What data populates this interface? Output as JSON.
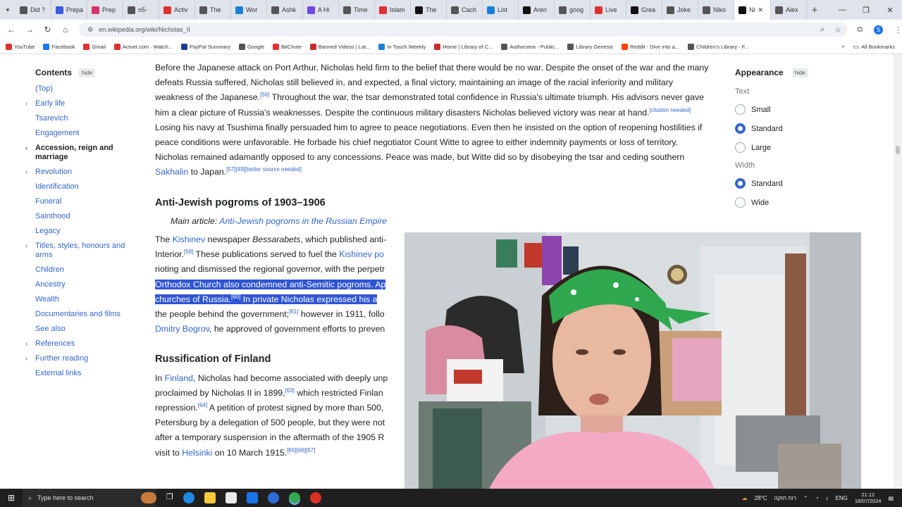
{
  "browser": {
    "tabs": [
      {
        "label": "Did ?",
        "color": "#555"
      },
      {
        "label": "Prepa",
        "color": "#3b5bdb"
      },
      {
        "label": "Prep",
        "color": "#d6336c"
      },
      {
        "label": "n5-",
        "color": "#555"
      },
      {
        "label": "Activ",
        "color": "#e03131"
      },
      {
        "label": "The",
        "color": "#555"
      },
      {
        "label": "Wor",
        "color": "#1c7ed6"
      },
      {
        "label": "Ashk",
        "color": "#555"
      },
      {
        "label": "A Hi",
        "color": "#7048e8"
      },
      {
        "label": "Time",
        "color": "#555"
      },
      {
        "label": "Islam",
        "color": "#e03131"
      },
      {
        "label": "The",
        "color": "#111"
      },
      {
        "label": "Cach",
        "color": "#555"
      },
      {
        "label": "List",
        "color": "#1c7ed6"
      },
      {
        "label": "Aren",
        "color": "#111"
      },
      {
        "label": "goog",
        "color": "#555"
      },
      {
        "label": "Live",
        "color": "#e03131"
      },
      {
        "label": "Grea",
        "color": "#111"
      },
      {
        "label": "Joke",
        "color": "#555"
      },
      {
        "label": "Niko",
        "color": "#555"
      },
      {
        "label": "Ni",
        "color": "#111",
        "active": true
      },
      {
        "label": "Alex",
        "color": "#555"
      }
    ],
    "url": "en.wikipedia.org/wiki/Nicholas_II",
    "bookmarks": [
      {
        "label": "YouTube",
        "color": "#e03131"
      },
      {
        "label": "Facebook",
        "color": "#1877f2"
      },
      {
        "label": "Gmail",
        "color": "#e03131"
      },
      {
        "label": "Actvet.com · Watch...",
        "color": "#e03131"
      },
      {
        "label": "PayPal Summary",
        "color": "#1c3f94"
      },
      {
        "label": "Google",
        "color": "#555"
      },
      {
        "label": "BitChute",
        "color": "#e03131"
      },
      {
        "label": "Banned Videos | Lat...",
        "color": "#c92a2a"
      },
      {
        "label": "In Touch Weekly",
        "color": "#1c7ed6"
      },
      {
        "label": "Home | Library of C...",
        "color": "#c92a2a"
      },
      {
        "label": "Authorsera - Public...",
        "color": "#555"
      },
      {
        "label": "Library Genesis",
        "color": "#555"
      },
      {
        "label": "Reddit - Dive into a...",
        "color": "#ff4500"
      },
      {
        "label": "Children's Library - F...",
        "color": "#555"
      }
    ],
    "bookmarks_more": "»",
    "all_bookmarks": "All Bookmarks"
  },
  "toc": {
    "title": "Contents",
    "hide": "hide",
    "items": [
      {
        "label": "(Top)",
        "chev": false
      },
      {
        "label": "Early life",
        "chev": true
      },
      {
        "label": "Tsarevich",
        "chev": false
      },
      {
        "label": "Engagement",
        "chev": false
      },
      {
        "label": "Accession, reign and marriage",
        "chev": true,
        "current": true
      },
      {
        "label": "Revolution",
        "chev": true
      },
      {
        "label": "Identification",
        "chev": false
      },
      {
        "label": "Funeral",
        "chev": false
      },
      {
        "label": "Sainthood",
        "chev": false
      },
      {
        "label": "Legacy",
        "chev": false
      },
      {
        "label": "Titles, styles, honours and arms",
        "chev": true
      },
      {
        "label": "Children",
        "chev": false
      },
      {
        "label": "Ancestry",
        "chev": false
      },
      {
        "label": "Wealth",
        "chev": false
      },
      {
        "label": "Documentaries and films",
        "chev": false
      },
      {
        "label": "See also",
        "chev": false
      },
      {
        "label": "References",
        "chev": true
      },
      {
        "label": "Further reading",
        "chev": true
      },
      {
        "label": "External links",
        "chev": false
      }
    ]
  },
  "article": {
    "p1": {
      "t1": "Before the Japanese attack on Port Arthur, Nicholas held firm to the belief that there would be no war. Despite the onset of the war and the many defeats Russia suffered, Nicholas still believed in, and expected, a final victory, maintaining an image of the racial inferiority and military weakness of the Japanese.",
      "r1": "[56]",
      "t2": " Throughout the war, the tsar demonstrated total confidence in Russia's ultimate triumph. His advisors never gave him a clear picture of Russia's weaknesses. Despite the continuous military disasters Nicholas believed victory was near at hand.",
      "r2": "[citation needed]",
      "t3": " Losing his navy at Tsushima finally persuaded him to agree to peace negotiations. Even then he insisted on the option of reopening hostilities if peace conditions were unfavorable. He forbade his chief negotiator Count Witte to agree to either indemnity payments or loss of territory. Nicholas remained adamantly opposed to any concessions. Peace was made, but Witte did so by disobeying the tsar and ceding southern ",
      "link": "Sakhalin",
      "t4": " to Japan.",
      "r3": "[57][49][better source needed]"
    },
    "h_pogroms": "Anti-Jewish pogroms of 1903–1906",
    "hatnote_prefix": "Main article: ",
    "hatnote_link": "Anti-Jewish pogroms in the Russian Empire",
    "p2": {
      "t1": "The ",
      "l1": "Kishinev",
      "t2": " newspaper ",
      "i1": "Bessarabets",
      "t3": ", which published anti-",
      "t4": "Interior.",
      "r1": "[58]",
      "t5": " These publications served to fuel the ",
      "l2": "Kishinev po",
      "t6": "rioting and dismissed the regional governor, with the perpetr",
      "h1": "Orthodox Church also condemned anti-Semitic pogroms. Ap",
      "h2": "churches of Russia.",
      "hr": "[60]",
      "h3": " In private Nicholas expressed his a",
      "t7": "the people behind the government;",
      "r2": "[61]",
      "t8": " however in 1911, follo",
      "l3": "Dmitry Bogrov",
      "t9": ", he approved of government efforts to preven"
    },
    "h_finland": "Russification of Finland",
    "p3": {
      "t1": "In ",
      "l1": "Finland",
      "t2": ", Nicholas had become associated with deeply unp",
      "t3": "proclaimed by Nicholas II in 1899,",
      "r1": "[63]",
      "t4": " which restricted Finlan",
      "t5": "repression.",
      "r2": "[64]",
      "t6": " A petition of protest signed by more than 500,",
      "t7": "Petersburg by a delegation of 500 people, but they were not",
      "t8": "after a temporary suspension in the aftermath of the 1905 R",
      "t9": "visit to ",
      "l2": "Helsinki",
      "t10": " on 10 March 1915.",
      "r3": "[65][66][67]"
    }
  },
  "appearance": {
    "title": "Appearance",
    "hide": "hide",
    "text_label": "Text",
    "text_options": [
      "Small",
      "Standard",
      "Large"
    ],
    "text_selected": 1,
    "width_label": "Width",
    "width_options": [
      "Standard",
      "Wide"
    ],
    "width_selected": 0
  },
  "taskbar": {
    "search_placeholder": "Type here to search",
    "weather": "28°C",
    "weather_desc": "רוח חזקה",
    "lang": "ENG",
    "time": "21:12",
    "date": "18/07/2024"
  }
}
